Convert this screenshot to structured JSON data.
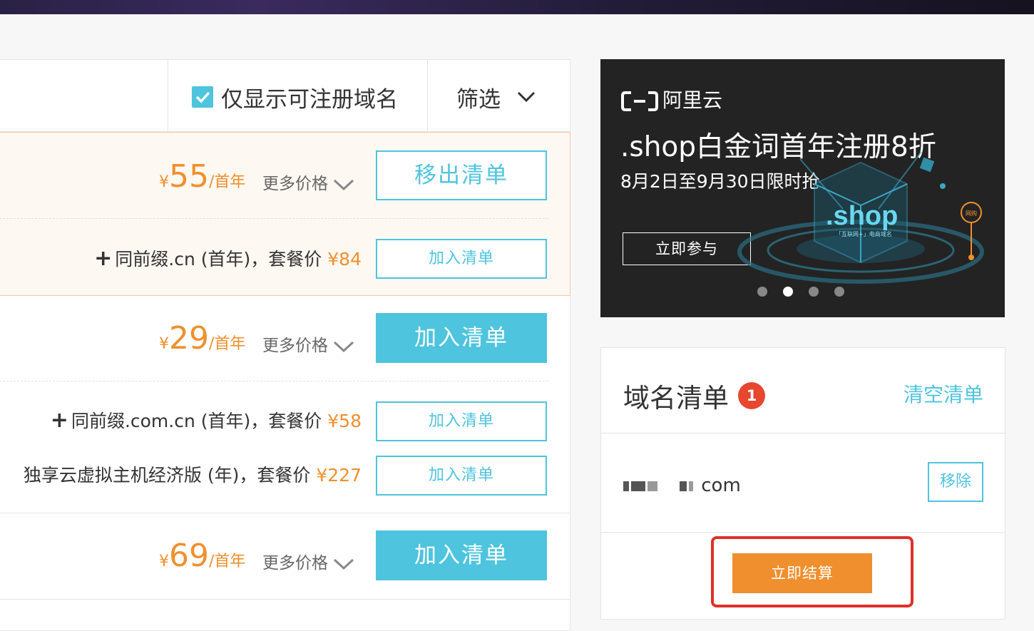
{
  "filter": {
    "checkbox_label": "仅显示可注册域名",
    "checkbox_checked": true,
    "filter_label": "筛选"
  },
  "results": [
    {
      "yen": "¥",
      "price": "55",
      "unit": "/首年",
      "more_prices": "更多价格",
      "action": "移出清单",
      "in_cart": true,
      "bundles": [
        {
          "text": "同前缀.cn (首年)，套餐价",
          "price": "¥84",
          "action": "加入清单"
        }
      ]
    },
    {
      "yen": "¥",
      "price": "29",
      "unit": "/首年",
      "more_prices": "更多价格",
      "action": "加入清单",
      "in_cart": false,
      "bundles": [
        {
          "text": "同前缀.com.cn (首年)，套餐价",
          "price": "¥58",
          "action": "加入清单"
        },
        {
          "text": "独享云虚拟主机经济版 (年)，套餐价",
          "price": "¥227",
          "action": "加入清单"
        }
      ]
    },
    {
      "yen": "¥",
      "price": "69",
      "unit": "/首年",
      "more_prices": "更多价格",
      "action": "加入清单",
      "in_cart": false,
      "bundles": []
    }
  ],
  "banner": {
    "brand": "阿里云",
    "headline": ".shop白金词首年注册8折",
    "subline": "8月2日至9月30日限时抢",
    "cta": "立即参与",
    "art_text": ".shop",
    "art_subtext": "「互联网+」电商域名",
    "art_badge": "网购",
    "slide_count": 4,
    "active_slide": 2
  },
  "cart": {
    "title": "域名清单",
    "count": "1",
    "clear": "清空清单",
    "items": [
      {
        "name_suffix": "com",
        "remove": "移除"
      }
    ],
    "checkout": "立即结算"
  },
  "colors": {
    "accent": "#4ec4de",
    "price": "#f0902e",
    "checkout": "#f08f2e",
    "badge": "#e7462f",
    "highlight": "#e0302a"
  }
}
